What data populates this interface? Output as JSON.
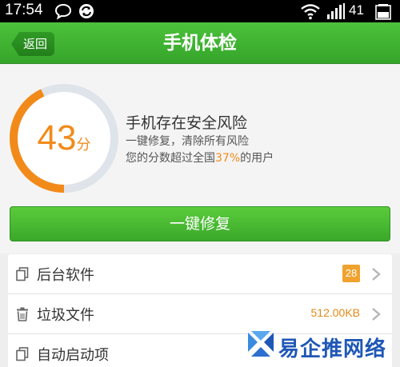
{
  "status_bar": {
    "time": "17:54",
    "battery_level": "41",
    "icons": [
      "chat-bubble-icon",
      "sync-icon",
      "wifi-icon",
      "signal-icon",
      "battery-icon"
    ]
  },
  "header": {
    "back_label": "返回",
    "title": "手机体检",
    "bar_color": "#3fb12f"
  },
  "score": {
    "value": "43",
    "unit": "分",
    "ring_fraction": 0.43,
    "accent_color": "#f28a1a",
    "risk_title": "手机存在安全风险",
    "risk_subtitle": "一键修复，清除所有风险",
    "beat_prefix": "您的分数超过全国",
    "beat_percent": "37%",
    "beat_suffix": "的用户"
  },
  "fix_button": {
    "label": "一键修复"
  },
  "items": [
    {
      "label": "后台软件",
      "value": "28",
      "icon": "copy-icon",
      "value_style": "badge"
    },
    {
      "label": "垃圾文件",
      "value": "512.00KB",
      "icon": "trash-icon",
      "value_style": "text"
    },
    {
      "label": "自动启动项",
      "value": "",
      "icon": "copy-icon",
      "value_style": "badge"
    }
  ],
  "watermark": {
    "text": "易企推网络"
  }
}
